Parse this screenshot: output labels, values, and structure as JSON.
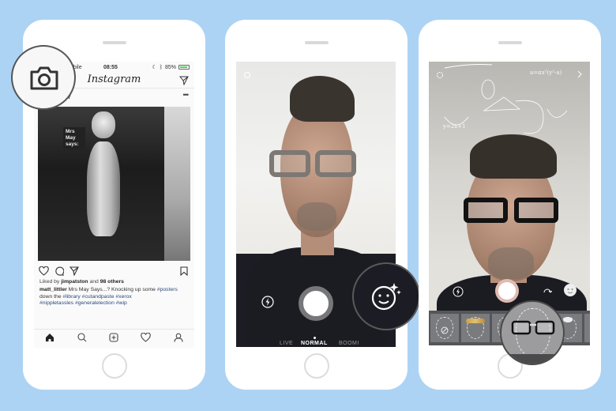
{
  "background_color": "#acd3f3",
  "phones": [
    {
      "name": "instagram-feed",
      "status_bar": {
        "carrier": "mobile",
        "time": "08:55",
        "battery": "85%"
      },
      "header": {
        "logo": "Instagram",
        "send_icon": "paper-plane-icon"
      },
      "post": {
        "username": "matt_littler",
        "username_visible": "_littler",
        "more_label": "•••",
        "image_label": "Mrs May says:",
        "likes_prefix": "Liked by ",
        "likes_user": "jimpatston",
        "likes_mid": " and ",
        "likes_count": "98 others",
        "caption_user": "matt_littler",
        "caption_text": " Mrs May Says...? Knocking up some ",
        "hashtags": [
          "#posters",
          "#library",
          "#cutandpaste",
          "#xerox",
          "#nippletassles",
          "#generalelection",
          "#wip"
        ],
        "caption_joins": [
          " down the ",
          " ",
          " ",
          "",
          " ",
          " "
        ]
      },
      "action_icons": [
        "heart-icon",
        "comment-icon",
        "share-icon",
        "bookmark-icon"
      ],
      "tab_icons": [
        "home-icon",
        "search-icon",
        "add-post-icon",
        "activity-heart-icon",
        "profile-icon"
      ],
      "callout": "camera-icon"
    },
    {
      "name": "camera-normal",
      "modes": [
        "LIVE",
        "NORMAL",
        "BOOMERANG"
      ],
      "modes_visible": [
        "LIVE",
        "NORMAL",
        "BOOMI"
      ],
      "selected_mode": "NORMAL",
      "icons": [
        "settings-icon",
        "flash-icon",
        "shutter-button",
        "face-filter-icon"
      ],
      "callout": "face-filter-icon"
    },
    {
      "name": "camera-face-filters",
      "icons": [
        "settings-icon",
        "chevron-right-icon",
        "flash-icon",
        "shutter-button",
        "flip-camera-icon",
        "face-filter-icon"
      ],
      "filters": [
        "none",
        "flower-crown",
        "koala",
        "glasses",
        "bunny",
        "sparkle"
      ],
      "selected_filter": "glasses",
      "doodles": [
        "a=αx²(y²-a)",
        "y=2x+1"
      ],
      "callout": "glasses-filter"
    }
  ]
}
